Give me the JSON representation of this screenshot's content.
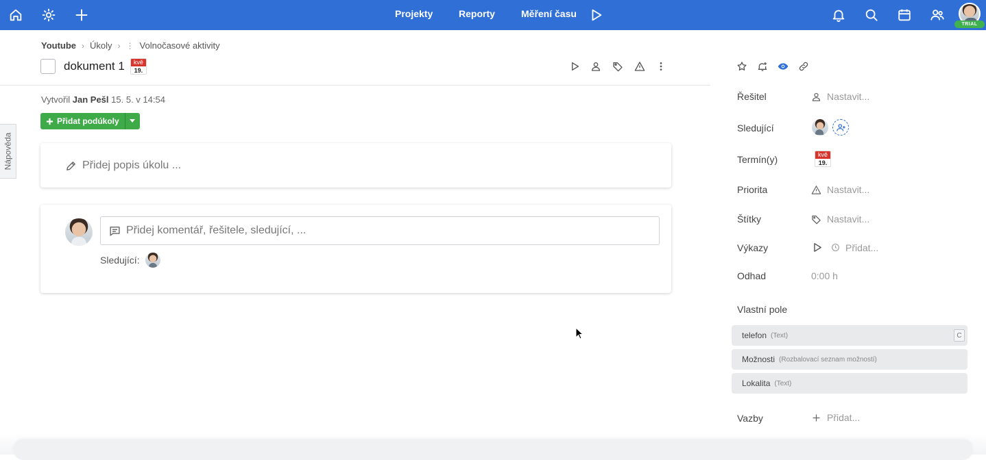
{
  "topbar": {
    "color": "#2f6fd6",
    "icons_left": [
      "home-icon",
      "settings-icon",
      "plus-icon"
    ],
    "nav": [
      "Projekty",
      "Reporty",
      "Měření času"
    ],
    "timer_icon": "play-icon",
    "icons_right": [
      "bell-icon",
      "search-icon",
      "calendar-icon",
      "users-icon"
    ],
    "trial_badge": "TRIAL"
  },
  "help_tab": "Nápověda",
  "breadcrumb": {
    "project": "Youtube",
    "section": "Úkoly",
    "list": "Volnočasové aktivity"
  },
  "task": {
    "title": "dokument 1",
    "due_month": "kvě",
    "due_day": "19.",
    "actions": [
      "play-icon",
      "user-icon",
      "tag-icon",
      "warning-icon",
      "more-icon"
    ],
    "created_prefix": "Vytvořil",
    "created_by": "Jan Pešl",
    "created_at": "15. 5. v 14:54",
    "add_subtasks": "Přidat podúkoly",
    "description_placeholder": "Přidej popis úkolu ...",
    "comment_placeholder": "Přidej komentář, řešitele, sledující, ...",
    "followers_label": "Sledující:"
  },
  "sidebar": {
    "header_icons": [
      "star-icon",
      "bell-plus-icon",
      "eye-icon",
      "link-icon"
    ],
    "accent": "#2f6fd6",
    "properties": {
      "assignee_label": "Řešitel",
      "assignee_value": "Nastavit...",
      "followers_label": "Sledující",
      "due_label": "Termín(y)",
      "due_month": "kvě",
      "due_day": "19.",
      "priority_label": "Priorita",
      "priority_value": "Nastavit...",
      "tags_label": "Štítky",
      "tags_value": "Nastavit...",
      "reports_label": "Výkazy",
      "reports_value": "Přidat...",
      "estimate_label": "Odhad",
      "estimate_value": "0:00 h",
      "custom_fields_label": "Vlastní pole",
      "relations_label": "Vazby",
      "relations_value": "Přidat..."
    },
    "custom_fields": [
      {
        "name": "telefon",
        "type": "(Text)",
        "key": "C"
      },
      {
        "name": "Možnosti",
        "type": "(Rozbalovací seznam možností)"
      },
      {
        "name": "Lokalita",
        "type": "(Text)"
      }
    ]
  }
}
